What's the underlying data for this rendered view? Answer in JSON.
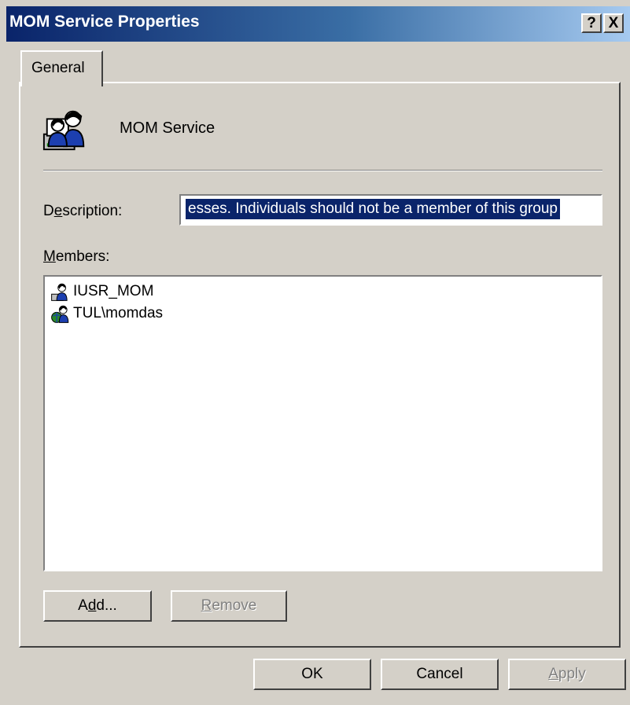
{
  "window": {
    "title": "MOM Service Properties",
    "help_glyph": "?",
    "close_glyph": "X"
  },
  "tabs": [
    {
      "label": "General",
      "selected": true
    }
  ],
  "service": {
    "name": "MOM Service",
    "icon": "group-icon"
  },
  "description": {
    "label_pre": "D",
    "label_accel": "e",
    "label_post": "scription:",
    "value": "esses. Individuals should not be a member of this group"
  },
  "members": {
    "label_accel": "M",
    "label_post": "embers:",
    "items": [
      {
        "name": "IUSR_MOM",
        "icon": "user-icon"
      },
      {
        "name": "TUL\\momdas",
        "icon": "domain-user-icon"
      }
    ]
  },
  "buttons": {
    "add": {
      "pre": "A",
      "accel": "d",
      "post": "d..."
    },
    "remove": {
      "accel": "R",
      "post": "emove",
      "disabled": true
    },
    "ok": "OK",
    "cancel": "Cancel",
    "apply": {
      "accel": "A",
      "post": "pply",
      "disabled": true
    }
  },
  "colors": {
    "face": "#d4d0c8",
    "title_start": "#0a246a",
    "title_end": "#a6caf0",
    "selection": "#0a246a"
  }
}
